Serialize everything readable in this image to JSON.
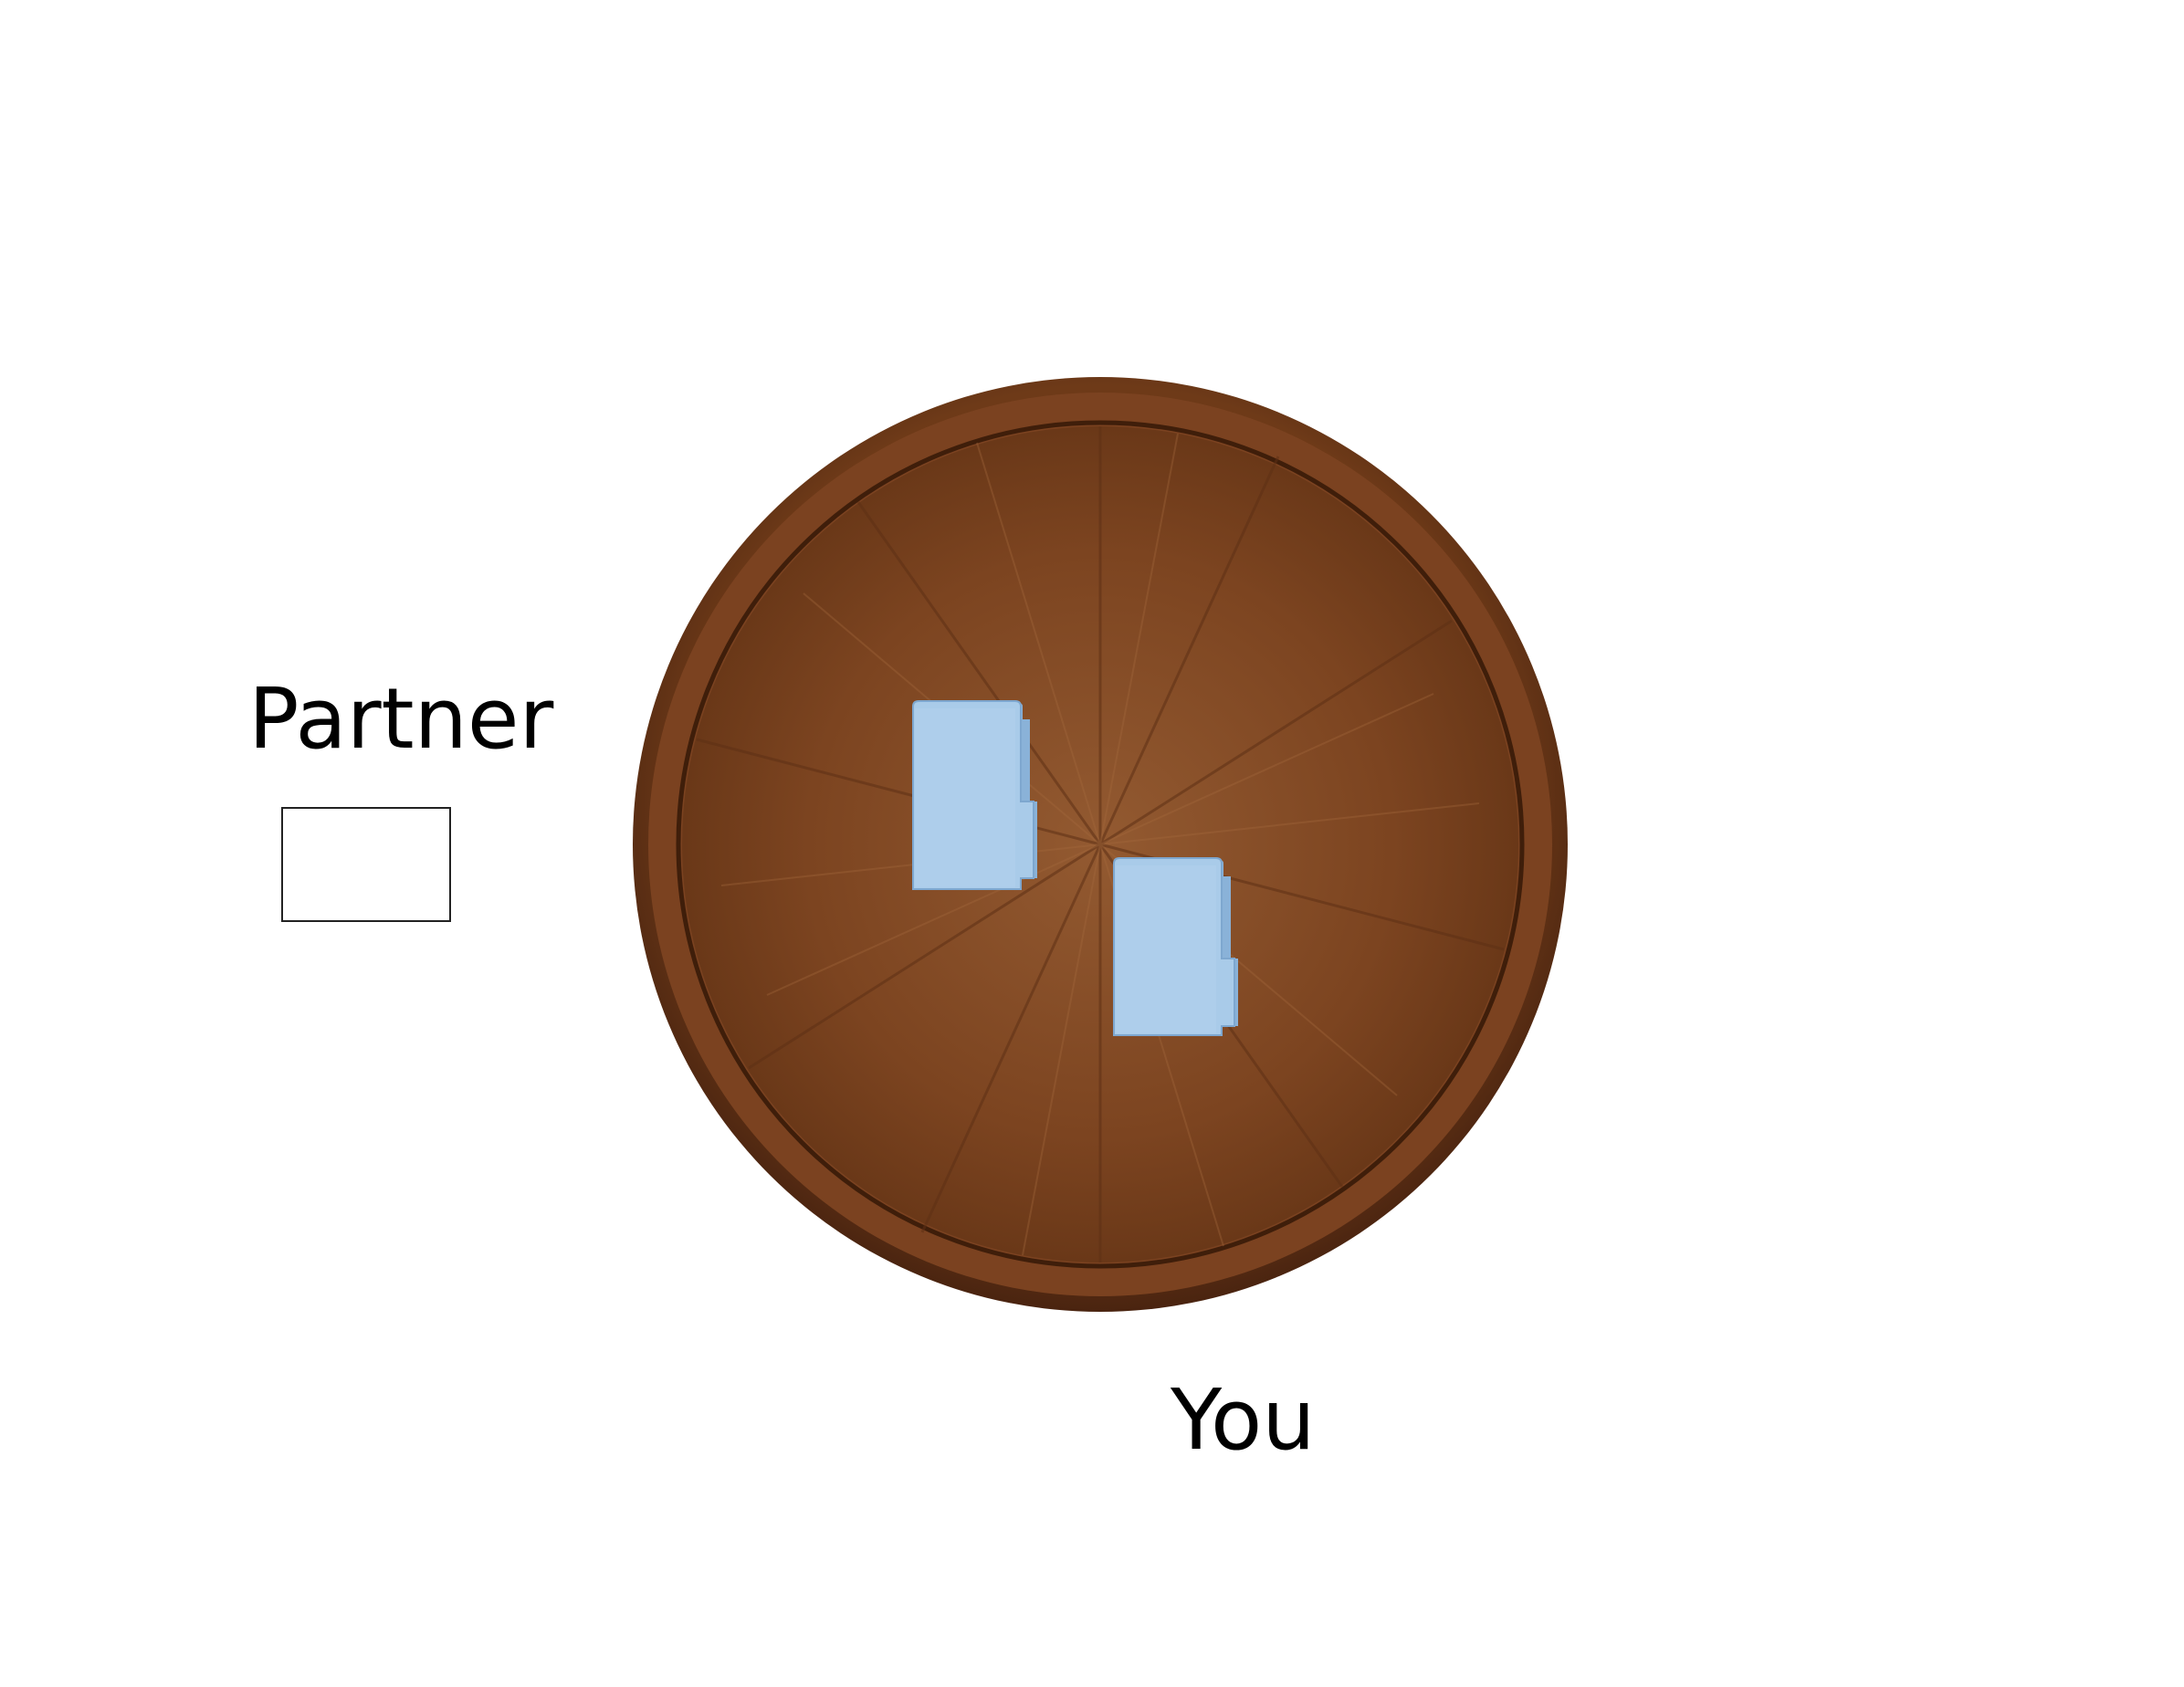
{
  "labels": {
    "partner": "Partner",
    "you": "You"
  },
  "icons": {
    "table": "round-wooden-table",
    "folder": "folder-icon"
  },
  "colors": {
    "wood_rim": "#5c2e12",
    "wood_top": "#7a4320",
    "wood_light": "#8e5530",
    "folder_fill": "#a3c6e6",
    "folder_edge": "#6f9cc6"
  }
}
